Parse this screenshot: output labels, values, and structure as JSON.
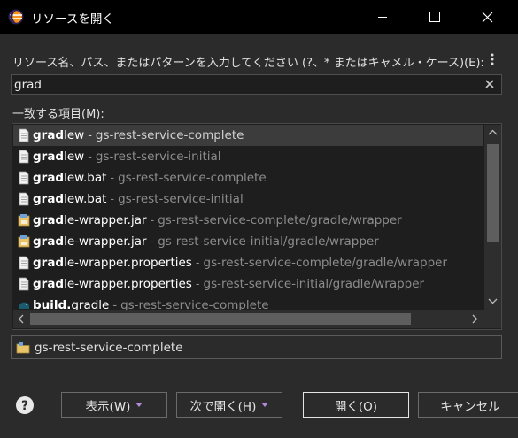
{
  "window": {
    "title": "リソースを開く",
    "minimize_glyph": "—",
    "maximize_glyph": "☐",
    "close_glyph": "✕"
  },
  "prompt": {
    "label": "リソース名、パス、またはパターンを入力してください (?、* またはキャメル・ケース)(E):",
    "menu_glyph": "⋮"
  },
  "search": {
    "value": "grad",
    "placeholder": ""
  },
  "matches": {
    "label": "一致する項目(M):",
    "items": [
      {
        "name_bold": "grad",
        "name_rest": "lew",
        "separator": "-",
        "path": "gs-rest-service-complete",
        "icon": "file-icon",
        "selected": true
      },
      {
        "name_bold": "grad",
        "name_rest": "lew",
        "separator": "-",
        "path": "gs-rest-service-initial",
        "icon": "file-icon",
        "selected": false
      },
      {
        "name_bold": "grad",
        "name_rest": "lew.bat",
        "separator": "-",
        "path": "gs-rest-service-complete",
        "icon": "file-icon",
        "selected": false
      },
      {
        "name_bold": "grad",
        "name_rest": "lew.bat",
        "separator": "-",
        "path": "gs-rest-service-initial",
        "icon": "file-icon",
        "selected": false
      },
      {
        "name_bold": "grad",
        "name_rest": "le-wrapper.jar",
        "separator": "-",
        "path": "gs-rest-service-complete/gradle/wrapper",
        "icon": "jar-icon",
        "selected": false
      },
      {
        "name_bold": "grad",
        "name_rest": "le-wrapper.jar",
        "separator": "-",
        "path": "gs-rest-service-initial/gradle/wrapper",
        "icon": "jar-icon",
        "selected": false
      },
      {
        "name_bold": "grad",
        "name_rest": "le-wrapper.properties",
        "separator": "-",
        "path": "gs-rest-service-complete/gradle/wrapper",
        "icon": "file-icon",
        "selected": false
      },
      {
        "name_bold": "grad",
        "name_rest": "le-wrapper.properties",
        "separator": "-",
        "path": "gs-rest-service-initial/gradle/wrapper",
        "icon": "file-icon",
        "selected": false
      },
      {
        "name_bold": "build.",
        "name_rest": "gradle",
        "separator": "-",
        "path": "gs-rest-service-complete",
        "icon": "gradle-icon",
        "selected": false
      }
    ]
  },
  "project": {
    "name": "gs-rest-service-complete",
    "icon": "project-folder-icon"
  },
  "buttons": {
    "show": "表示(W)",
    "open_with": "次で開く(H)",
    "open": "開く(O)",
    "cancel": "キャンセル"
  },
  "colors": {
    "background": "#2b2b2b",
    "titlebar": "#000000",
    "list_background": "#1e1e1e",
    "selected_row": "#3c3c3c",
    "path_text": "#8c8c8c",
    "dropdown_accent": "#b48ad8"
  }
}
